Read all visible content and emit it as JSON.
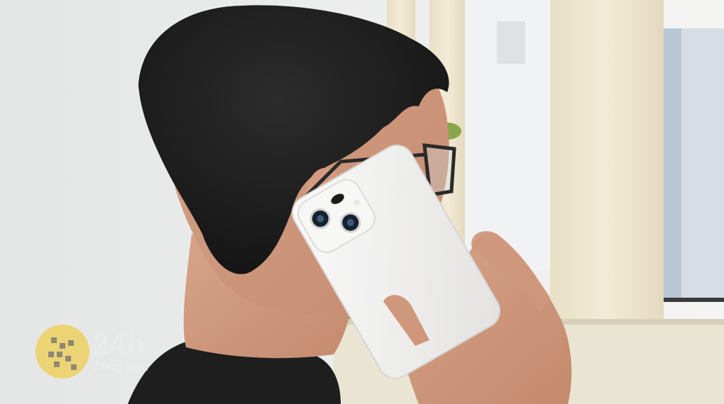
{
  "image": {
    "subject": "photograph",
    "colors": {
      "wall": "#eeefef",
      "pillar": "#efe6cf",
      "hair": "#1c1c1c",
      "skin": "#d9a68c",
      "phone": "#f3f2f0",
      "shirt": "#1e1e1e",
      "glasses": "#2a2a2a"
    }
  },
  "watermark": {
    "brand_number": "24h",
    "brand_text": "Công ngh",
    "badge_color": "#f2c417"
  }
}
